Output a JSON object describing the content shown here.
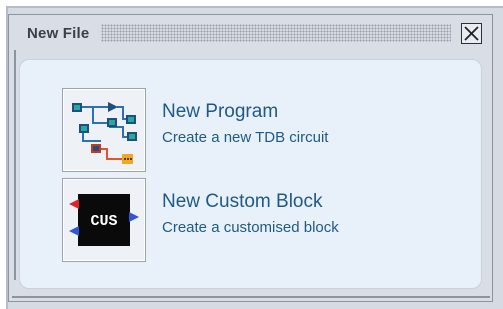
{
  "dialog": {
    "title": "New File",
    "close_icon": "close-icon"
  },
  "items": [
    {
      "title": "New Program",
      "description": "Create a new TDB circuit",
      "icon": "circuit-diagram-icon"
    },
    {
      "title": "New Custom Block",
      "description": "Create a customised block",
      "icon": "custom-block-icon",
      "icon_label": "CUS"
    }
  ],
  "colors": {
    "panel_background": "#d9dde6",
    "content_background": "#e8f0fa",
    "link_text": "#1f5a86"
  }
}
